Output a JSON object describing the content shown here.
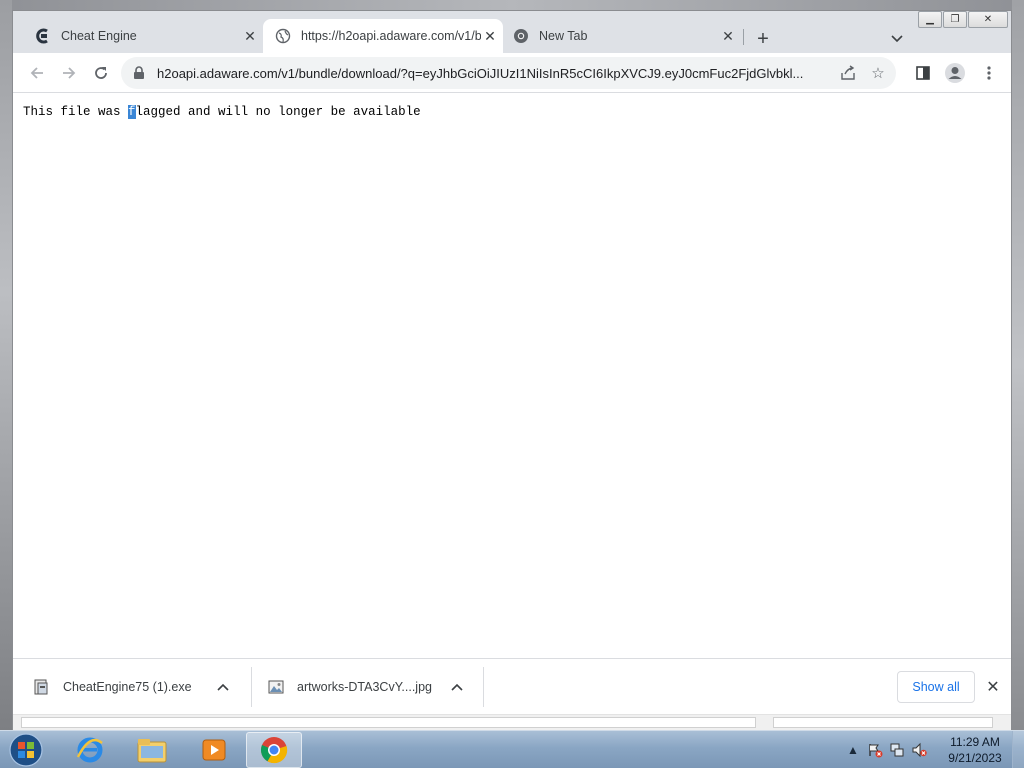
{
  "tabs": [
    {
      "title": "Cheat Engine",
      "icon": "cheat-engine-icon"
    },
    {
      "title": "https://h2oapi.adaware.com/v1/b",
      "icon": "globe-icon",
      "active": true
    },
    {
      "title": "New Tab",
      "icon": "chrome-icon"
    }
  ],
  "toolbar": {
    "url": "h2oapi.adaware.com/v1/bundle/download/?q=eyJhbGciOiJIUzI1NiIsInR5cCI6IkpXVCJ9.eyJ0cmFuc2FjdGlvbkl..."
  },
  "content": {
    "message_before": "This file was ",
    "message_caret": "f",
    "message_after": "lagged and will no longer be available"
  },
  "downloads": {
    "items": [
      {
        "name": "CheatEngine75 (1).exe",
        "icon": "installer-icon"
      },
      {
        "name": "artworks-DTA3CvY....jpg",
        "icon": "image-file-icon"
      }
    ],
    "show_all": "Show all"
  },
  "taskbar": {
    "time": "11:29 AM",
    "date": "9/21/2023",
    "apps": [
      "internet-explorer-icon",
      "file-explorer-icon",
      "media-player-icon",
      "chrome-icon"
    ]
  },
  "colors": {
    "accent": "#1a73e8",
    "tabstrip": "#dee1e6",
    "selection": "#3a86d6"
  }
}
